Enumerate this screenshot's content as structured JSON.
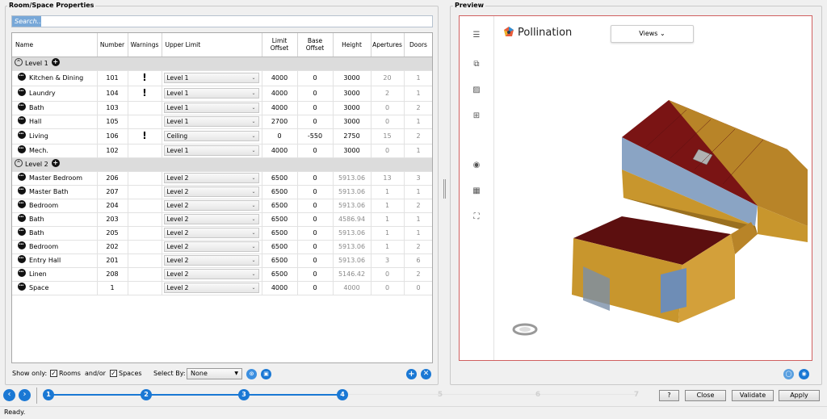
{
  "left_panel": {
    "title": "Room/Space Properties",
    "search_placeholder": "Search.."
  },
  "columns": [
    "Name",
    "Number",
    "Warnings",
    "Upper Limit",
    "Limit Offset",
    "Base Offset",
    "Height",
    "Apertures",
    "Doors"
  ],
  "levels": [
    {
      "label": "Level 1",
      "rows": [
        {
          "name": "Kitchen & Dining",
          "number": "101",
          "warning": "!",
          "upper": "Level 1",
          "limit": "4000",
          "base": "0",
          "height": "3000",
          "apertures": "20",
          "doors": "1"
        },
        {
          "name": "Laundry",
          "number": "104",
          "warning": "!",
          "upper": "Level 1",
          "limit": "4000",
          "base": "0",
          "height": "3000",
          "apertures": "2",
          "doors": "1"
        },
        {
          "name": "Bath",
          "number": "103",
          "warning": "",
          "upper": "Level 1",
          "limit": "4000",
          "base": "0",
          "height": "3000",
          "apertures": "0",
          "doors": "2"
        },
        {
          "name": "Hall",
          "number": "105",
          "warning": "",
          "upper": "Level 1",
          "limit": "2700",
          "base": "0",
          "height": "3000",
          "apertures": "0",
          "doors": "1"
        },
        {
          "name": "Living",
          "number": "106",
          "warning": "!",
          "upper": "Ceiling",
          "limit": "0",
          "base": "-550",
          "height": "2750",
          "apertures": "15",
          "doors": "2"
        },
        {
          "name": "Mech.",
          "number": "102",
          "warning": "",
          "upper": "Level 1",
          "limit": "4000",
          "base": "0",
          "height": "3000",
          "apertures": "0",
          "doors": "1"
        }
      ]
    },
    {
      "label": "Level 2",
      "rows": [
        {
          "name": "Master Bedroom",
          "number": "206",
          "warning": "",
          "upper": "Level 2",
          "limit": "6500",
          "base": "0",
          "height": "5913.06",
          "apertures": "13",
          "doors": "3"
        },
        {
          "name": "Master Bath",
          "number": "207",
          "warning": "",
          "upper": "Level 2",
          "limit": "6500",
          "base": "0",
          "height": "5913.06",
          "apertures": "1",
          "doors": "1"
        },
        {
          "name": "Bedroom",
          "number": "204",
          "warning": "",
          "upper": "Level 2",
          "limit": "6500",
          "base": "0",
          "height": "5913.06",
          "apertures": "1",
          "doors": "2"
        },
        {
          "name": "Bath",
          "number": "203",
          "warning": "",
          "upper": "Level 2",
          "limit": "6500",
          "base": "0",
          "height": "4586.94",
          "apertures": "1",
          "doors": "1"
        },
        {
          "name": "Bath",
          "number": "205",
          "warning": "",
          "upper": "Level 2",
          "limit": "6500",
          "base": "0",
          "height": "5913.06",
          "apertures": "1",
          "doors": "1"
        },
        {
          "name": "Bedroom",
          "number": "202",
          "warning": "",
          "upper": "Level 2",
          "limit": "6500",
          "base": "0",
          "height": "5913.06",
          "apertures": "1",
          "doors": "2"
        },
        {
          "name": "Entry Hall",
          "number": "201",
          "warning": "",
          "upper": "Level 2",
          "limit": "6500",
          "base": "0",
          "height": "5913.06",
          "apertures": "3",
          "doors": "6"
        },
        {
          "name": "Linen",
          "number": "208",
          "warning": "",
          "upper": "Level 2",
          "limit": "6500",
          "base": "0",
          "height": "5146.42",
          "apertures": "0",
          "doors": "2"
        },
        {
          "name": "Space",
          "number": "1",
          "warning": "",
          "upper": "Level 2",
          "limit": "4000",
          "base": "0",
          "height": "4000",
          "apertures": "0",
          "doors": "0"
        }
      ]
    }
  ],
  "filter": {
    "show_only": "Show only:",
    "rooms": "Rooms",
    "andor": "and/or",
    "spaces": "Spaces",
    "select_by": "Select By:",
    "select_value": "None"
  },
  "preview": {
    "title": "Preview",
    "brand": "Pollination",
    "views": "Views"
  },
  "steps": [
    "1",
    "2",
    "3",
    "4",
    "5",
    "6",
    "7"
  ],
  "buttons": {
    "help": "?",
    "close": "Close",
    "validate": "Validate",
    "apply": "Apply"
  },
  "status": "Ready.",
  "colors": {
    "accent": "#1a78d4",
    "roof": "#7a1414",
    "wall": "#c8962d",
    "glass": "#6e8db6",
    "preview_border": "#d06060"
  }
}
